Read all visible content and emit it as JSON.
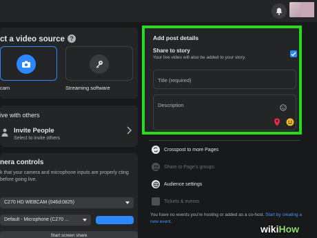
{
  "header": {
    "notifications_icon": "bell-icon",
    "avatar_icon": "avatar"
  },
  "video_source": {
    "title": "ct a video source",
    "help_glyph": "?",
    "options": [
      {
        "label": "cam",
        "icon": "camera-icon",
        "selected": true
      },
      {
        "label": "Streaming software",
        "icon": "key-icon",
        "selected": false
      }
    ]
  },
  "share": {
    "title": "ive with others",
    "invite_label": "Invite People",
    "invite_sub": "Select to invite others"
  },
  "camera_controls": {
    "title": "nera controls",
    "description": "k that your camera and microphone inputs are properly cting before going live.",
    "camera_select": "C270 HD WEBCAM (046d:0825)",
    "mic_select": "Default - Microphone (C270 ...",
    "screen_share_label": "Start screen share"
  },
  "post_details": {
    "title": "Add post details",
    "share_story_label": "Share to story",
    "share_story_sub": "Your live video will also be added to your story.",
    "share_story_checked": true,
    "title_placeholder": "Title (required)",
    "description_placeholder": "Description"
  },
  "side_options": [
    {
      "label": "Crosspost to more Pages",
      "icon": "crosspost-icon",
      "enabled": true
    },
    {
      "label": "Share to Page's groups",
      "icon": "groups-icon",
      "enabled": false
    },
    {
      "label": "Audience settings",
      "icon": "globe-icon",
      "enabled": true
    },
    {
      "label": "Tickets & events",
      "icon": "ticket-icon",
      "enabled": false
    }
  ],
  "footer": {
    "text": "You have no events you're hosting or added as a co-host.",
    "link_text": "Start by creating a new event."
  },
  "watermark": {
    "wiki": "wiki",
    "how": "How"
  },
  "colors": {
    "accent": "#2d88ff",
    "highlight": "#2bd91c",
    "bg": "#18191a",
    "card": "#242526"
  }
}
